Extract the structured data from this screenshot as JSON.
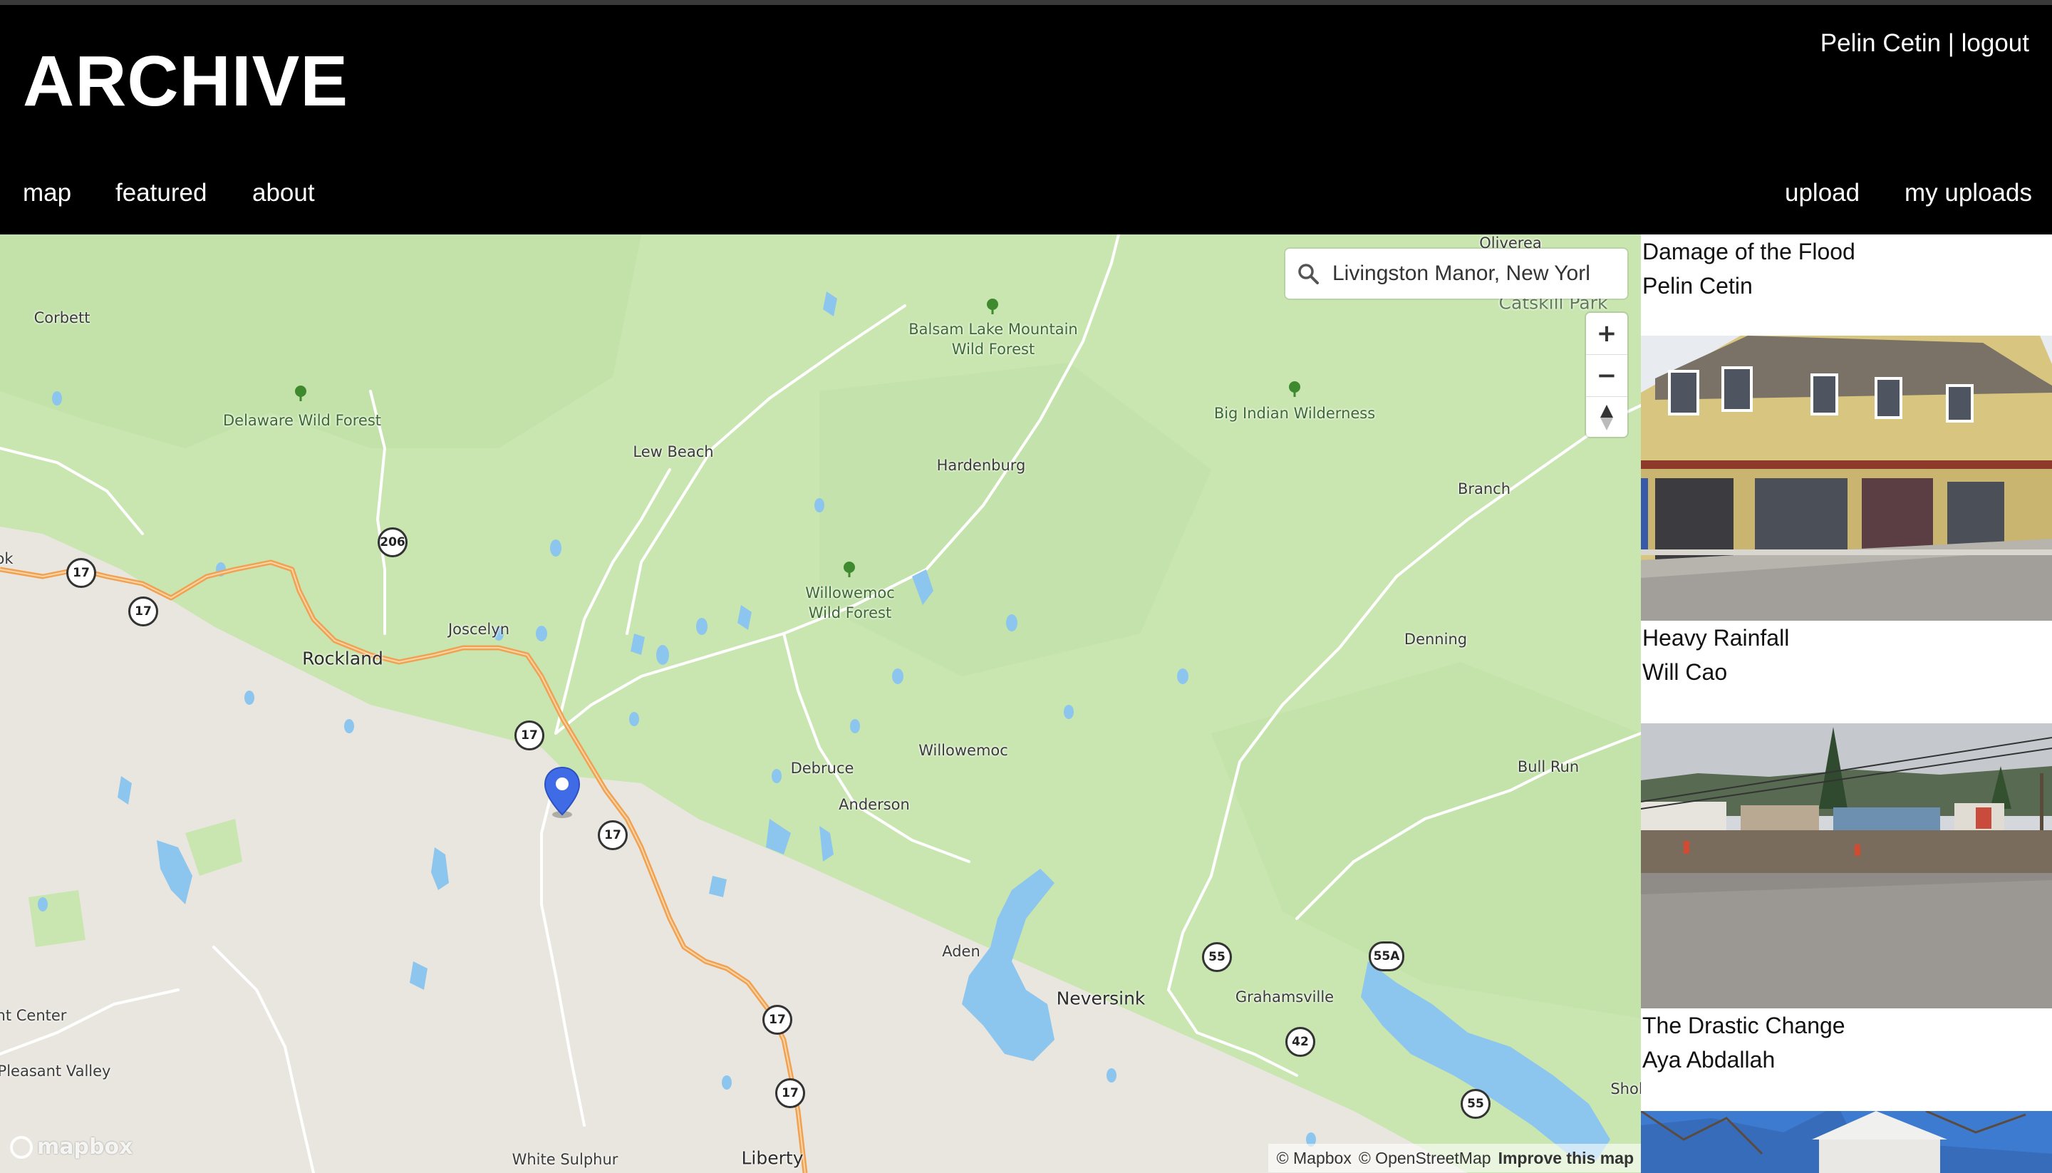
{
  "header": {
    "logo": "ARCHIVE",
    "user_name": "Pelin Cetin",
    "separator": "|",
    "logout": "logout",
    "nav_left": [
      "map",
      "featured",
      "about"
    ],
    "nav_right": [
      "upload",
      "my uploads"
    ]
  },
  "map": {
    "search": {
      "value": "Livingston Manor, New York",
      "icon": "search-icon"
    },
    "zoom_in": "+",
    "zoom_out": "−",
    "compass": "compass-icon",
    "logo_text": "mapbox",
    "attribution": [
      "© Mapbox",
      "© OpenStreetMap"
    ],
    "improve": "Improve this map",
    "marker": "location-pin-icon",
    "colors": {
      "forest": "#c9e5b0",
      "land": "#e9e6df",
      "water": "#8cc6ee",
      "highway": "#f0a253"
    },
    "labels": {
      "oliverea": "Oliverea",
      "catskill": "Catskill Park",
      "corbett": "Corbett",
      "balsam": [
        "Balsam Lake Mountain",
        "Wild Forest"
      ],
      "delaware": "Delaware Wild Forest",
      "big_indian": "Big Indian Wilderness",
      "lew_beach": "Lew Beach",
      "hardenburg": "Hardenburg",
      "branch": "Branch",
      "willowemoc_wf": [
        "Willowemoc",
        "Wild Forest"
      ],
      "joscelyn": "Joscelyn",
      "rockland": "Rockland",
      "denning": "Denning",
      "bull_run": "Bull Run",
      "debruce": "Debruce",
      "willowemoc": "Willowemoc",
      "anderson": "Anderson",
      "aden": "Aden",
      "neversink": "Neversink",
      "grahamsville": "Grahamsville",
      "mount_center": "nt Center",
      "pleasant_valley": "Pleasant Valley",
      "white_sulphur": "White Sulphur",
      "liberty": "Liberty",
      "shol": "Shol",
      "ok": "ok"
    },
    "shields": [
      "17",
      "17",
      "206",
      "17",
      "17",
      "17",
      "17",
      "55",
      "55A",
      "42",
      "55"
    ]
  },
  "sidebar": {
    "cards": [
      {
        "title": "Damage of the Flood",
        "author": "Pelin Cetin"
      },
      {
        "title": "Heavy Rainfall",
        "author": "Will Cao"
      },
      {
        "title": "The Drastic Change",
        "author": "Aya Abdallah"
      }
    ]
  }
}
